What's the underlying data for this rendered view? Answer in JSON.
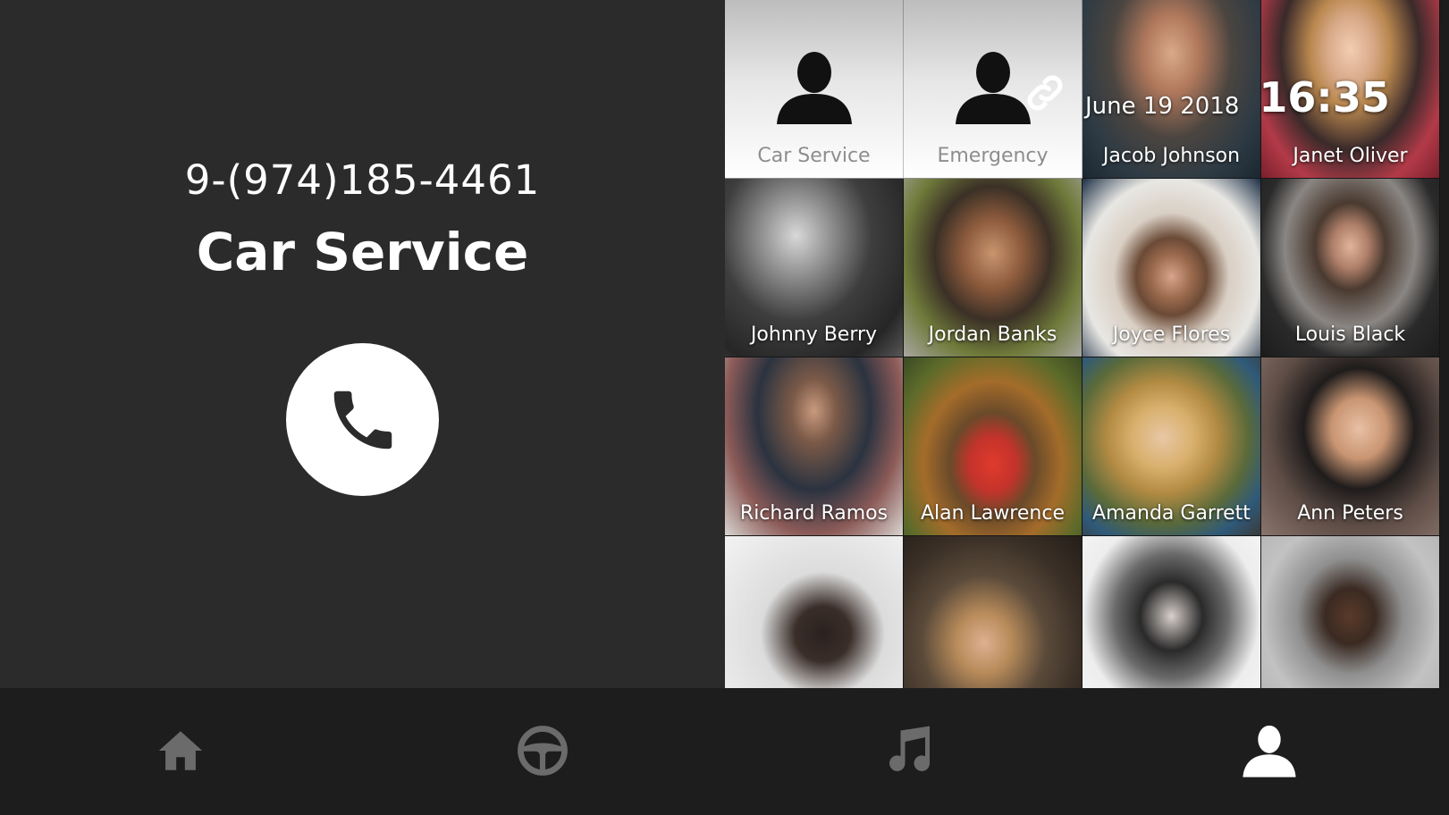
{
  "call": {
    "number": "9-(974)185-4461",
    "name": "Car Service"
  },
  "status": {
    "date": "June 19 2018",
    "time": "16:35"
  },
  "contacts": [
    {
      "name": "Car Service",
      "style": "placeholder"
    },
    {
      "name": "Emergency",
      "style": "placeholder"
    },
    {
      "name": "Jacob Johnson",
      "style": "photo"
    },
    {
      "name": "Janet Oliver",
      "style": "photo"
    },
    {
      "name": "Johnny Berry",
      "style": "photo"
    },
    {
      "name": "Jordan Banks",
      "style": "photo"
    },
    {
      "name": "Joyce Flores",
      "style": "photo"
    },
    {
      "name": "Louis Black",
      "style": "photo"
    },
    {
      "name": "Richard Ramos",
      "style": "photo"
    },
    {
      "name": "Alan Lawrence",
      "style": "photo"
    },
    {
      "name": "Amanda Garrett",
      "style": "photo"
    },
    {
      "name": "Ann Peters",
      "style": "photo"
    },
    {
      "name": "",
      "style": "photo"
    },
    {
      "name": "",
      "style": "photo"
    },
    {
      "name": "",
      "style": "photo"
    },
    {
      "name": "",
      "style": "photo"
    }
  ],
  "nav": {
    "items": [
      "home-icon",
      "steering-wheel-icon",
      "music-note-icon",
      "contacts-person-icon"
    ],
    "active_index": 3
  },
  "colors": {
    "panel_bg": "#2b2b2c",
    "nav_bg": "#1d1d1e",
    "nav_icon_inactive": "#6b6b6b",
    "nav_icon_active": "#ffffff"
  }
}
